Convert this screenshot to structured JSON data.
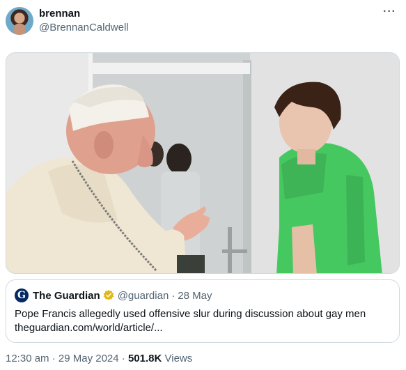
{
  "author": {
    "display_name": "brennan",
    "handle": "@BrennanCaldwell"
  },
  "more_label": "···",
  "quoted_tweet": {
    "source_name": "The Guardian",
    "source_logo_letter": "G",
    "handle": "@guardian",
    "separator": "·",
    "date": "28 May",
    "headline": "Pope Francis allegedly used offensive slur during discussion about gay men",
    "link": "theguardian.com/world/article/..."
  },
  "meta": {
    "time": "12:30 am",
    "separator": "·",
    "date": "29 May 2024",
    "views_count": "501.8K",
    "views_label": "Views"
  },
  "icons": {
    "verified": "verified-badge-icon",
    "more": "more-options-icon"
  },
  "colors": {
    "verified_gold": "#e2b719",
    "guardian_blue": "#052962",
    "shirt_green": "#3fcf5e",
    "secondary_text": "#536471"
  }
}
